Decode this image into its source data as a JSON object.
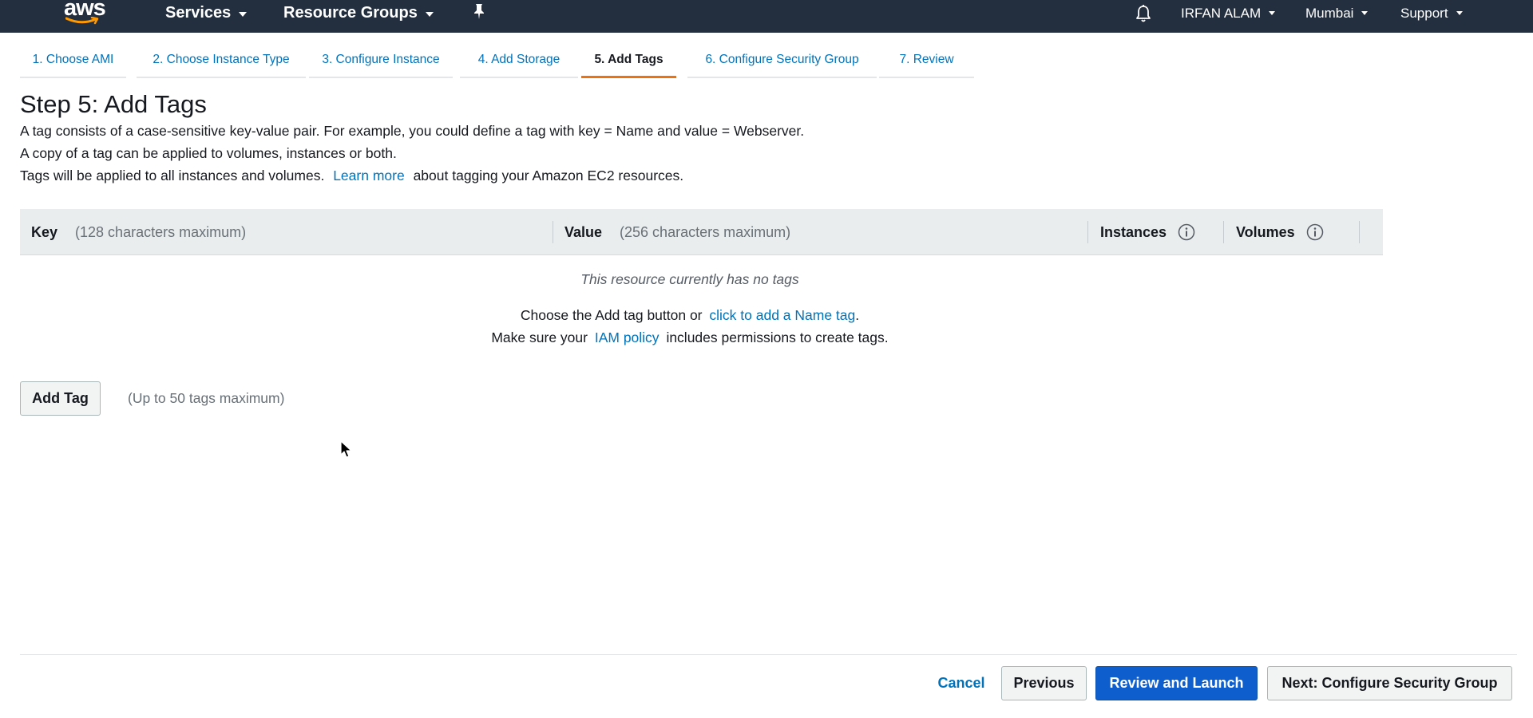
{
  "nav": {
    "logo_text": "aws",
    "services_label": "Services",
    "resource_groups_label": "Resource Groups",
    "pin_icon": "pin-icon",
    "bell_icon": "bell-icon",
    "user_label": "IRFAN ALAM",
    "region_label": "Mumbai",
    "support_label": "Support"
  },
  "steps": [
    {
      "label": "1. Choose AMI",
      "active": false
    },
    {
      "label": "2. Choose Instance Type",
      "active": false
    },
    {
      "label": "3. Configure Instance",
      "active": false
    },
    {
      "label": "4. Add Storage",
      "active": false
    },
    {
      "label": "5. Add Tags",
      "active": true
    },
    {
      "label": "6. Configure Security Group",
      "active": false
    },
    {
      "label": "7. Review",
      "active": false
    }
  ],
  "page": {
    "title": "Step 5: Add Tags",
    "intro_1": "A tag consists of a case-sensitive key-value pair. For example, you could define a tag with key = Name and value = Webserver.",
    "intro_2": "A copy of a tag can be applied to volumes, instances or both.",
    "intro_3_prefix": "Tags will be applied to all instances and volumes.",
    "learn_more": "Learn more",
    "intro_3_suffix": "about tagging your Amazon EC2 resources."
  },
  "table": {
    "key_label": "Key",
    "key_hint": "(128 characters maximum)",
    "value_label": "Value",
    "value_hint": "(256 characters maximum)",
    "instances_label": "Instances",
    "volumes_label": "Volumes",
    "info_icon": "info-icon",
    "empty_message": "This resource currently has no tags",
    "choose_prefix": "Choose the Add tag button or",
    "name_tag_link": "click to add a Name tag",
    "choose_suffix": ".",
    "iam_prefix": "Make sure your",
    "iam_link": "IAM policy",
    "iam_suffix": "includes permissions to create tags."
  },
  "actions": {
    "add_tag": "Add Tag",
    "tag_limit": "(Up to 50 tags maximum)",
    "cancel": "Cancel",
    "previous": "Previous",
    "review_launch": "Review and Launch",
    "next": "Next: Configure Security Group"
  },
  "colors": {
    "nav_bg": "#232f3e",
    "link": "#0073bb",
    "active_tab": "#ec7211",
    "primary_button": "#0e5fcd"
  }
}
